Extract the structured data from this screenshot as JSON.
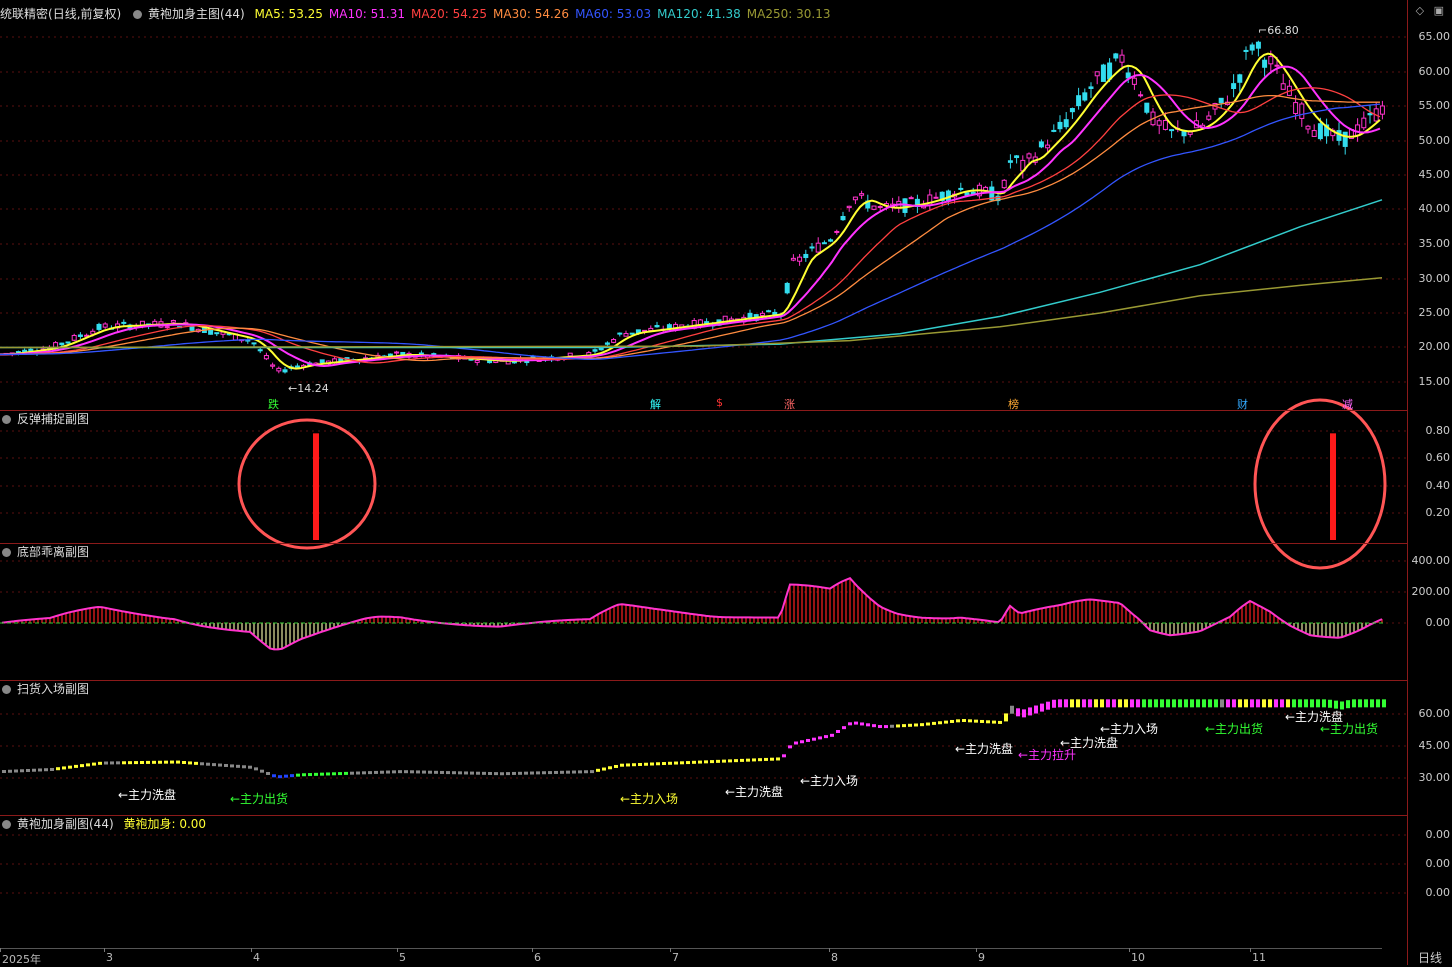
{
  "main_header": {
    "stock_name": "统联精密",
    "period": "(日线,前复权)",
    "indicator": "黄袍加身主图(44)",
    "ma": [
      {
        "label": "MA5: 53.25",
        "color": "#ffff33"
      },
      {
        "label": "MA10: 51.31",
        "color": "#ff33ff"
      },
      {
        "label": "MA20: 54.25",
        "color": "#ff4040"
      },
      {
        "label": "MA30: 54.26",
        "color": "#ff8c40"
      },
      {
        "label": "MA60: 53.03",
        "color": "#3355ff"
      },
      {
        "label": "MA120: 41.38",
        "color": "#33cccc"
      },
      {
        "label": "MA250: 30.13",
        "color": "#999933"
      }
    ]
  },
  "window_controls": {
    "diamond": "◇",
    "restore": "▣"
  },
  "price_axis": [
    "65.00",
    "60.00",
    "55.00",
    "50.00",
    "45.00",
    "40.00",
    "35.00",
    "30.00",
    "25.00",
    "20.00",
    "15.00"
  ],
  "annotations": {
    "high": "66.80",
    "low": "14.24"
  },
  "markers": [
    {
      "text": "跌",
      "color": "#33ff33"
    },
    {
      "text": "解",
      "color": "#33ffff"
    },
    {
      "text": "$",
      "color": "#ff3333"
    },
    {
      "text": "涨",
      "color": "#ff6666"
    },
    {
      "text": "榜",
      "color": "#ffaa33"
    },
    {
      "text": "财",
      "color": "#33aaff"
    },
    {
      "text": "减",
      "color": "#ff66ff"
    }
  ],
  "panel1": {
    "title": "反弹捕捉副图",
    "axis": [
      "0.80",
      "0.60",
      "0.40",
      "0.20"
    ],
    "values": [
      0.8,
      0.8
    ]
  },
  "panel2": {
    "title": "底部乖离副图",
    "axis": [
      "400.00",
      "200.00",
      "0.00"
    ]
  },
  "panel3": {
    "title": "扫货入场副图",
    "axis": [
      "60.00",
      "45.00",
      "30.00"
    ],
    "labels": [
      {
        "text": "主力洗盘",
        "color": "#ffffff"
      },
      {
        "text": "主力出货",
        "color": "#33ff33"
      },
      {
        "text": "主力入场",
        "color": "#ffff33"
      },
      {
        "text": "主力洗盘",
        "color": "#ffffff"
      },
      {
        "text": "主力入场",
        "color": "#ffffff"
      },
      {
        "text": "主力洗盘",
        "color": "#ffffff"
      },
      {
        "text": "主力拉升",
        "color": "#ff33ff"
      },
      {
        "text": "主力洗盘",
        "color": "#ffffff"
      },
      {
        "text": "主力入场",
        "color": "#ffffff"
      },
      {
        "text": "主力出货",
        "color": "#33ff33"
      },
      {
        "text": "主力洗盘",
        "color": "#ffffff"
      },
      {
        "text": "主力出货",
        "color": "#33ff33"
      }
    ]
  },
  "panel4": {
    "title": "黄袍加身副图(44)",
    "value_label": "黄袍加身: 0.00",
    "axis": [
      "0.00",
      "0.00",
      "0.00"
    ]
  },
  "dates": [
    "2025年",
    "3",
    "4",
    "5",
    "6",
    "7",
    "8",
    "9",
    "10",
    "11"
  ],
  "period_tab": "日线"
}
